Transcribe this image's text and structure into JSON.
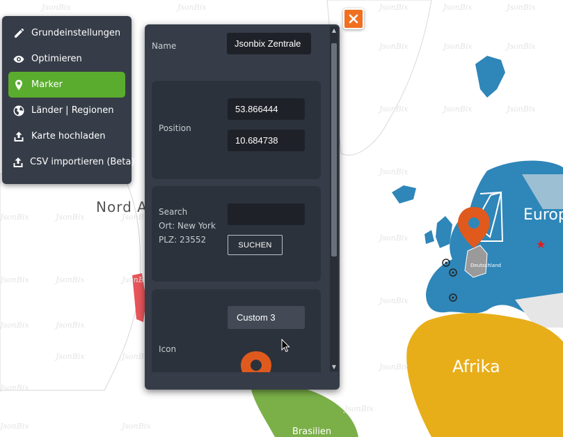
{
  "menu": {
    "items": [
      {
        "label": "Grundeinstellungen",
        "icon": "pencil-icon",
        "active": false
      },
      {
        "label": "Optimieren",
        "icon": "eye-icon",
        "active": false
      },
      {
        "label": "Marker",
        "icon": "map-pin-icon",
        "active": true
      },
      {
        "label": "Länder | Regionen",
        "icon": "globe-icon",
        "active": false
      },
      {
        "label": "Karte hochladen",
        "icon": "upload-icon",
        "active": false
      },
      {
        "label": "CSV importieren (Beta)",
        "icon": "upload-icon",
        "active": false
      }
    ]
  },
  "panel": {
    "name_label": "Name",
    "name_value": "Jsonbix Zentrale",
    "position_label": "Position",
    "latitude": "53.866444",
    "longitude": "10.684738",
    "search_label_1": "Search",
    "search_label_2": "Ort: New York",
    "search_label_3": "PLZ: 23552",
    "search_value": "",
    "search_button": "SUCHEN",
    "icon_label": "Icon",
    "icon_select": "Custom 3"
  },
  "map": {
    "watermark": "JsonBix",
    "labels": {
      "north_america": "Nord A",
      "europe": "Europ",
      "africa": "Afrika",
      "germany": "Deutschland",
      "brazil": "Brasilien"
    }
  },
  "colors": {
    "panel_bg": "#363d48",
    "card_bg": "#2c323c",
    "active_menu": "#5aac2e",
    "close_button": "#f07020",
    "europe": "#2f86b8",
    "africa": "#e8ae1a",
    "marker": "#e05a1e"
  }
}
